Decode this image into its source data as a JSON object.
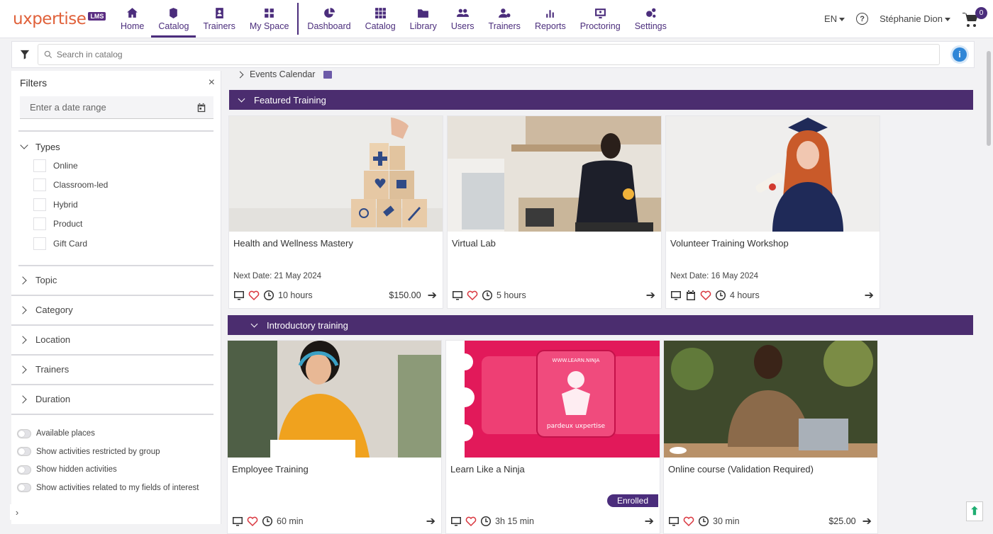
{
  "brand": {
    "logo_text": "uxpertise",
    "badge": "LMS",
    "logo_color": "#e0613a"
  },
  "nav": {
    "learner": [
      {
        "label": "Home",
        "icon": "home-icon"
      },
      {
        "label": "Catalog",
        "icon": "catalog-icon",
        "active": true
      },
      {
        "label": "Trainers",
        "icon": "trainer-badge-icon"
      },
      {
        "label": "My Space",
        "icon": "grid-icon"
      }
    ],
    "admin": [
      {
        "label": "Dashboard",
        "icon": "pie-chart-icon"
      },
      {
        "label": "Catalog",
        "icon": "apps-grid-icon"
      },
      {
        "label": "Library",
        "icon": "folder-icon"
      },
      {
        "label": "Users",
        "icon": "users-icon"
      },
      {
        "label": "Trainers",
        "icon": "user-settings-icon"
      },
      {
        "label": "Reports",
        "icon": "bar-chart-icon"
      },
      {
        "label": "Proctoring",
        "icon": "monitor-user-icon"
      },
      {
        "label": "Settings",
        "icon": "gears-icon"
      }
    ],
    "language": "EN",
    "help": "?",
    "user_name": "Stéphanie Dion",
    "cart_count": "0",
    "accent_color": "#4b2d7c"
  },
  "search": {
    "placeholder": "Search in catalog",
    "info": "i"
  },
  "filters": {
    "title": "Filters",
    "close": "×",
    "date_placeholder": "Enter a date range",
    "types_label": "Types",
    "types": [
      "Online",
      "Classroom-led",
      "Hybrid",
      "Product",
      "Gift Card"
    ],
    "sections": [
      "Topic",
      "Category",
      "Location",
      "Trainers",
      "Duration"
    ],
    "toggles": [
      "Available places",
      "Show activities restricted by group",
      "Show hidden activities",
      "Show activities related to my fields of interest"
    ]
  },
  "main": {
    "events_calendar": "Events Calendar",
    "featured": {
      "title": "Featured Training",
      "cards": [
        {
          "title": "Health and Wellness Mastery",
          "date": "Next Date: 21 May 2024",
          "duration": "10 hours",
          "price": "$150.00",
          "image": "wooden-medical-blocks"
        },
        {
          "title": "Virtual Lab",
          "date": "",
          "duration": "5 hours",
          "price": "",
          "image": "woman-at-laptop-kitchen"
        },
        {
          "title": "Volunteer Training Workshop",
          "date": "Next Date: 16 May 2024",
          "duration": "4 hours",
          "price": "",
          "image": "graduate-with-diploma"
        }
      ]
    },
    "introductory": {
      "title": "Introductory training",
      "cards": [
        {
          "title": "Employee Training",
          "duration": "60 min",
          "price": "",
          "image": "woman-with-headphones"
        },
        {
          "title": "Learn Like a Ninja",
          "duration": "3h 15 min",
          "price": "",
          "badge": "Enrolled",
          "image": "ninja-banner",
          "ninja_url": "WWW.LEARN.NINJA",
          "ninja_brand": "pardeux uxpertise"
        },
        {
          "title": "Online course (Validation Required)",
          "duration": "30 min",
          "price": "$25.00",
          "image": "man-writing-laptop"
        }
      ]
    }
  },
  "colors": {
    "section_bar": "#4b2d6f",
    "heart": "#d9363e",
    "info": "#2f86d7",
    "scroll_up": "#1fae72"
  }
}
